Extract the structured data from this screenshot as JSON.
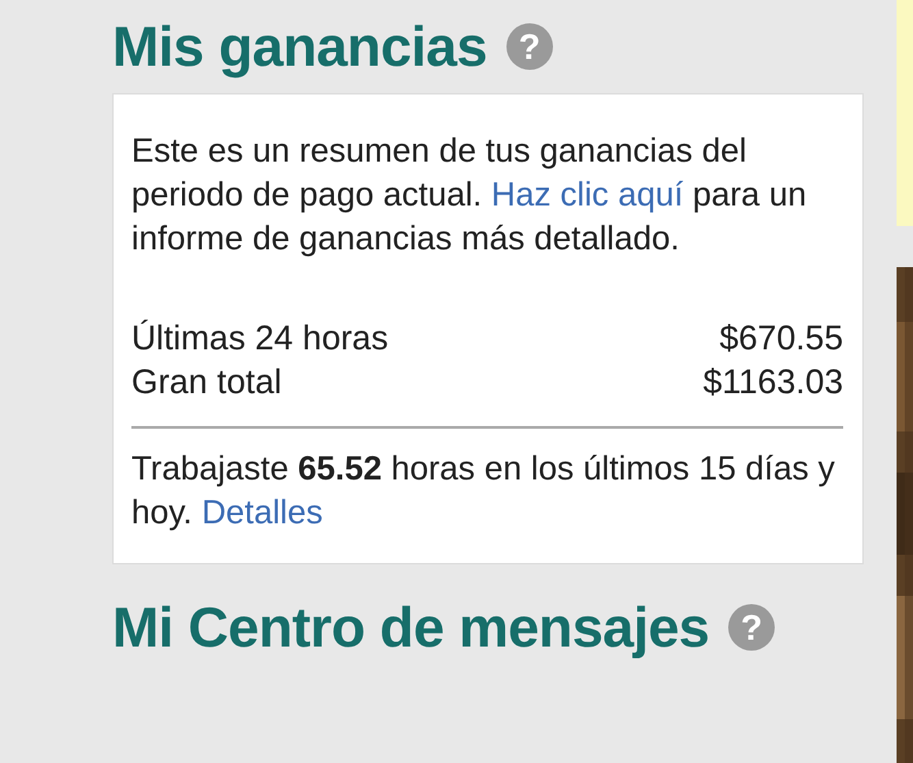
{
  "earnings": {
    "title": "Mis ganancias",
    "help": "?",
    "intro": "Este es un resumen de tus ganancias del periodo de pago actual.",
    "intro_link": "Haz clic aquí",
    "intro_rest": "para un informe de ganancias más detallado.",
    "rows": [
      {
        "label": "Últimas 24 horas",
        "value": "$670.55"
      },
      {
        "label": "Gran total",
        "value": "$1163.03"
      }
    ],
    "worked": "Trabajaste **65.52** horas en los últimos 15 días y hoy.",
    "worked_link": "Detalles"
  },
  "messages": {
    "title": "Mi Centro de mensajes",
    "help": "?"
  }
}
